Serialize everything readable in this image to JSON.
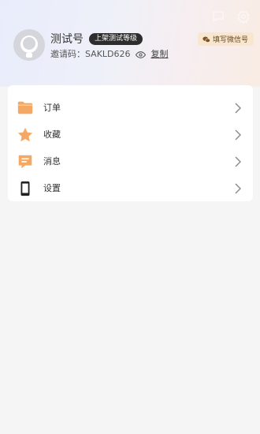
{
  "profile": {
    "username": "测试号",
    "level_badge": "上架测试等级",
    "invite_label": "邀请码：",
    "invite_code": "SAKLD626",
    "copy_label": "复制"
  },
  "header": {
    "wechat_button_label": "填写微信号",
    "icons": [
      "message-icon",
      "settings-gear-icon"
    ]
  },
  "menu": {
    "items": [
      {
        "label": "订单",
        "icon": "folder-icon"
      },
      {
        "label": "收藏",
        "icon": "star-icon"
      },
      {
        "label": "消息",
        "icon": "message-icon"
      },
      {
        "label": "设置",
        "icon": "phone-icon"
      }
    ]
  },
  "colors": {
    "accent_orange": "#f5a863",
    "badge_dark": "#2d2d2d",
    "wechat_bg": "#f8e6cf"
  }
}
